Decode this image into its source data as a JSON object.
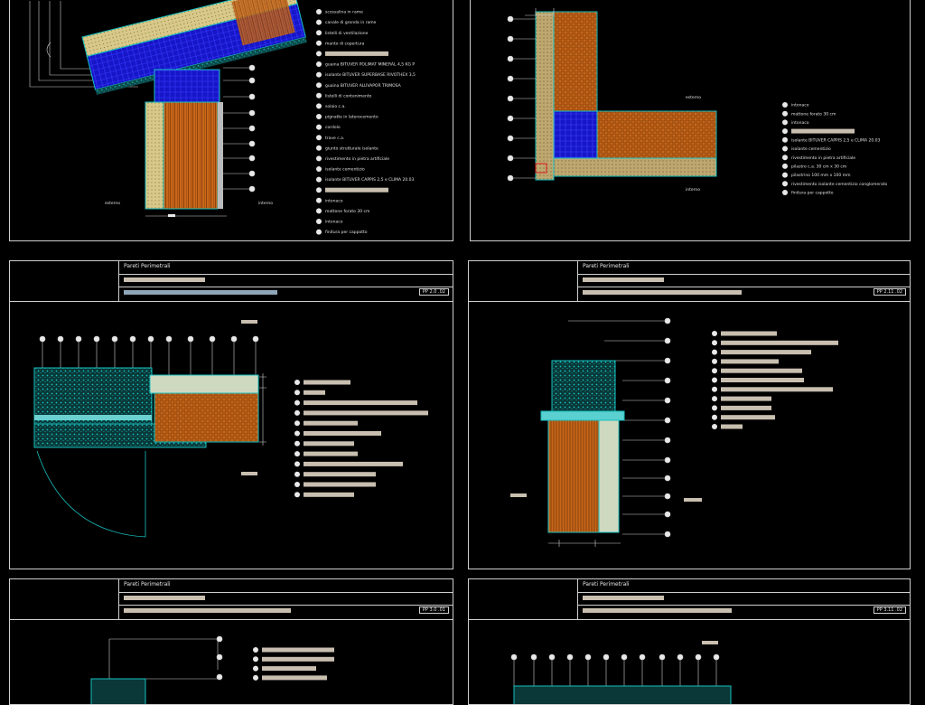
{
  "sheets": {
    "s3": {
      "title": "Pareti Perimetrali",
      "code": "PP 2.0 .02"
    },
    "s4": {
      "title": "Pareti Perimetrali",
      "code": "PP 2.11 .02"
    },
    "s5": {
      "title": "Pareti Perimetrali",
      "code": "PP 3.0 .01"
    },
    "s6": {
      "title": "Pareti Perimetrali",
      "code": "PP 3.11 .02"
    }
  },
  "legend_s1": [
    "scossalina in rame",
    "canale di gronda in rame",
    "listelli di ventilazione",
    "manto di copertura",
    "",
    "guaina BITUVER POLIMAT MINERAL 4,5 KG P",
    "isolante BITUVER SUPERBASE RIVOTHEX 3,5",
    "guaina BITUVER ALUVAPOR TRIMOSA",
    "listelli di contenimento",
    "solaio c.a.",
    "pignatte in laterocemento",
    "cordolo",
    "trave c.a.",
    "giunto strutturale isolante",
    "rivestimento in pietra artificiale",
    "isolante cementizio",
    "isolante BITUVER CAPPIS 2,5 e CLIMA 20.03",
    "",
    "intonaco",
    "mattone forato 30 cm",
    "intonaco",
    "finitura per cappotto"
  ],
  "legend_s2": [
    "intonaco",
    "mattone forato 30 cm",
    "intonaco",
    "",
    "isolante BITUVER CAPPIS 2,5 e CLIMA 20.03",
    "isolante cementizio",
    "rivestimento in pietra artificiale",
    "pilastro c.a. 30 cm x 30 cm",
    "pilastrino 100 mm x 100 mm",
    "rivestimento isolante cementizio conglomerato",
    "finitura per cappotto"
  ],
  "labels": {
    "s1_left": "esterno",
    "s1_right": "interno",
    "s2_top": "esterno",
    "s2_bottom": "interno"
  },
  "colors": {
    "line": "#cfcfcf",
    "orange": "#d3721d",
    "blue": "#1616c8",
    "cyan": "#14a6a6",
    "sand": "#d8c98a",
    "bar": "#c9bfb0"
  }
}
